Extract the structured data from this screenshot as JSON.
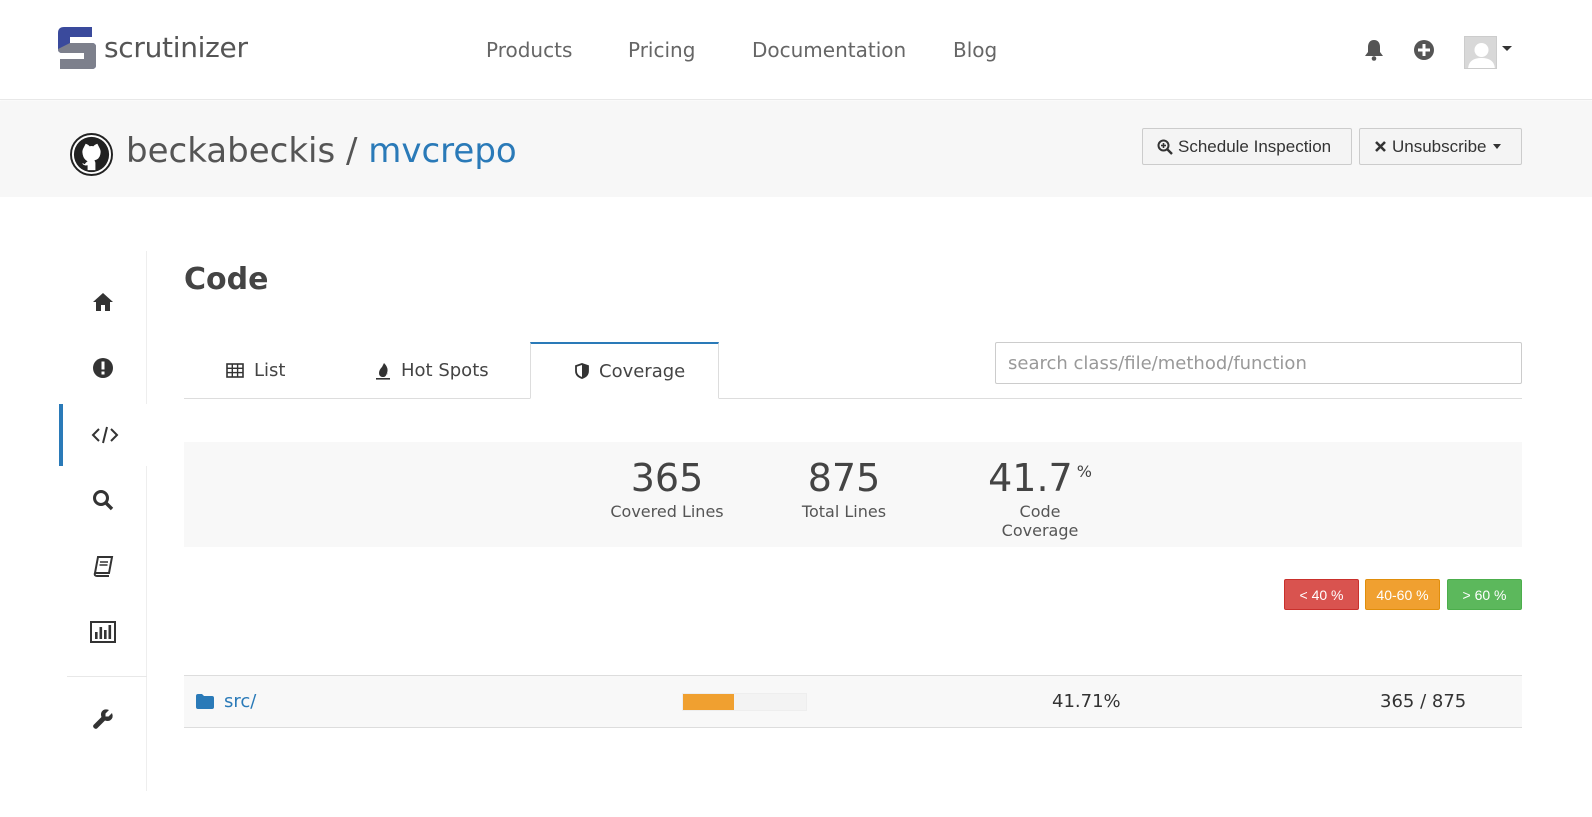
{
  "brand": {
    "name": "scrutinizer"
  },
  "nav": {
    "products": "Products",
    "pricing": "Pricing",
    "documentation": "Documentation",
    "blog": "Blog"
  },
  "repo": {
    "owner": "beckabeckis",
    "separator": " / ",
    "name": "mvcrepo"
  },
  "actions": {
    "schedule": "Schedule Inspection",
    "unsubscribe": "Unsubscribe"
  },
  "page": {
    "title": "Code"
  },
  "tabs": [
    {
      "label": "List",
      "icon": "table-icon"
    },
    {
      "label": "Hot Spots",
      "icon": "fire-icon"
    },
    {
      "label": "Coverage",
      "icon": "shield-icon",
      "active": true
    }
  ],
  "search": {
    "placeholder": "search class/file/method/function",
    "value": ""
  },
  "stats": {
    "covered": {
      "value": "365",
      "label": "Covered Lines"
    },
    "total": {
      "value": "875",
      "label": "Total Lines"
    },
    "coverage": {
      "value": "41.7",
      "unit": "%",
      "label": "Code Coverage"
    }
  },
  "legend": {
    "low": "< 40 %",
    "mid": "40-60 %",
    "high": "> 60 %"
  },
  "rows": [
    {
      "name": "src/",
      "pct": "41.71%",
      "ratio": "365 / 875",
      "fraction": 0.4171
    }
  ],
  "colors": {
    "accent": "#2a7ab8",
    "low": "#d9534f",
    "mid": "#f0a030",
    "high": "#5cb85c"
  },
  "rail": [
    "home-icon",
    "alert-icon",
    "code-icon",
    "search-icon",
    "book-icon",
    "chart-icon",
    "wrench-icon"
  ]
}
